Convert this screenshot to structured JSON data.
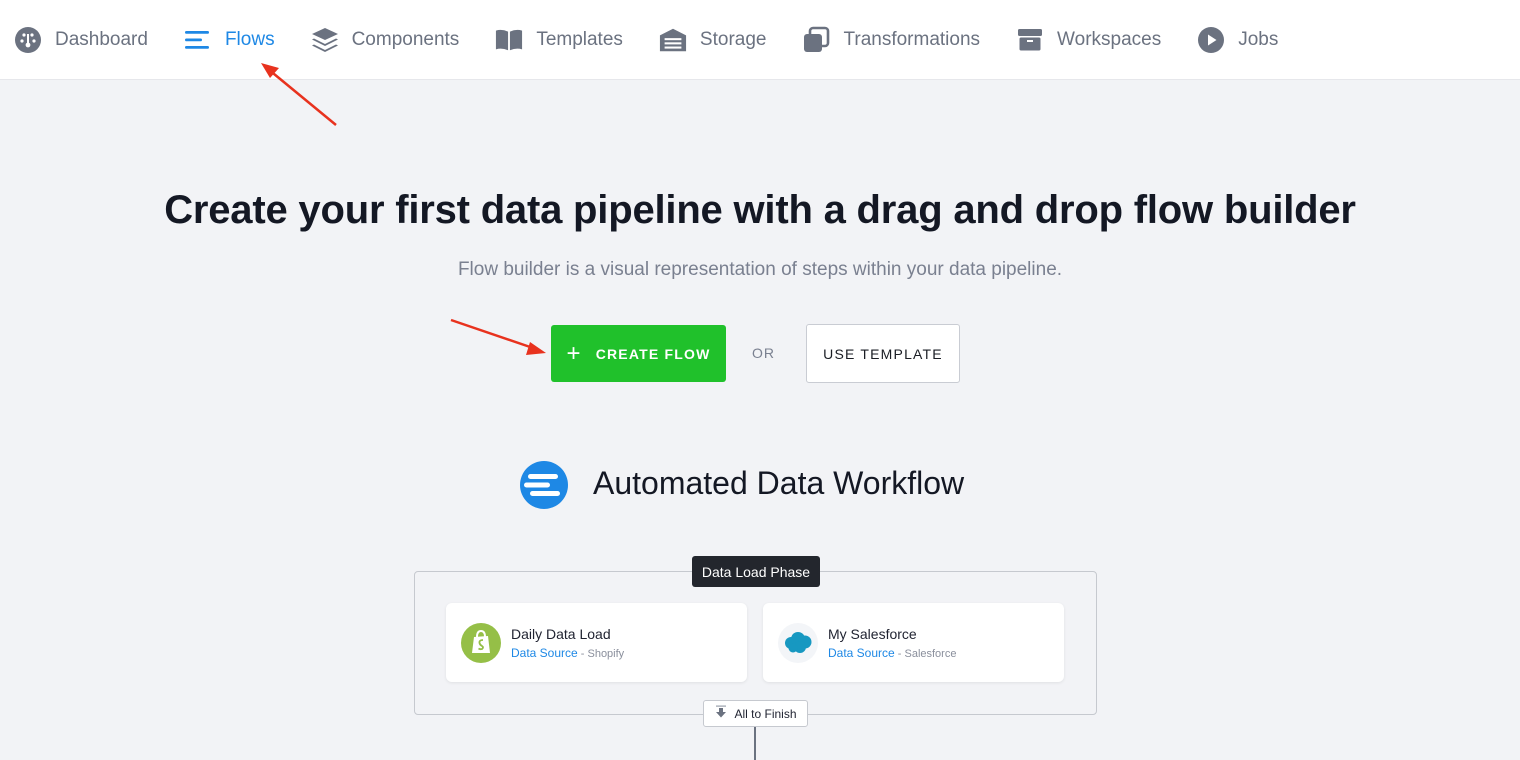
{
  "nav": {
    "items": [
      {
        "label": "Dashboard",
        "icon": "dashboard-gauge-icon"
      },
      {
        "label": "Flows",
        "icon": "flows-lines-icon",
        "active": true
      },
      {
        "label": "Components",
        "icon": "layers-icon"
      },
      {
        "label": "Templates",
        "icon": "book-icon"
      },
      {
        "label": "Storage",
        "icon": "warehouse-icon"
      },
      {
        "label": "Transformations",
        "icon": "transformations-icon"
      },
      {
        "label": "Workspaces",
        "icon": "box-icon"
      },
      {
        "label": "Jobs",
        "icon": "play-circle-icon"
      }
    ]
  },
  "hero": {
    "title": "Create your first data pipeline with a drag and drop flow builder",
    "subtitle": "Flow builder is a visual representation of steps within your data pipeline."
  },
  "actions": {
    "create_flow": "CREATE FLOW",
    "or": "OR",
    "use_template": "USE TEMPLATE"
  },
  "workflow": {
    "title": "Automated Data Workflow",
    "phase_label": "Data Load Phase",
    "cards": [
      {
        "name": "Daily Data Load",
        "type": "Data Source",
        "source": "Shopify"
      },
      {
        "name": "My Salesforce",
        "type": "Data Source",
        "source": "Salesforce"
      }
    ],
    "finish_label": "All to Finish"
  },
  "colors": {
    "accent_blue": "#1e88e5",
    "create_green": "#20c12b",
    "annotation_red": "#e8321e",
    "nav_gray": "#6b7280"
  }
}
